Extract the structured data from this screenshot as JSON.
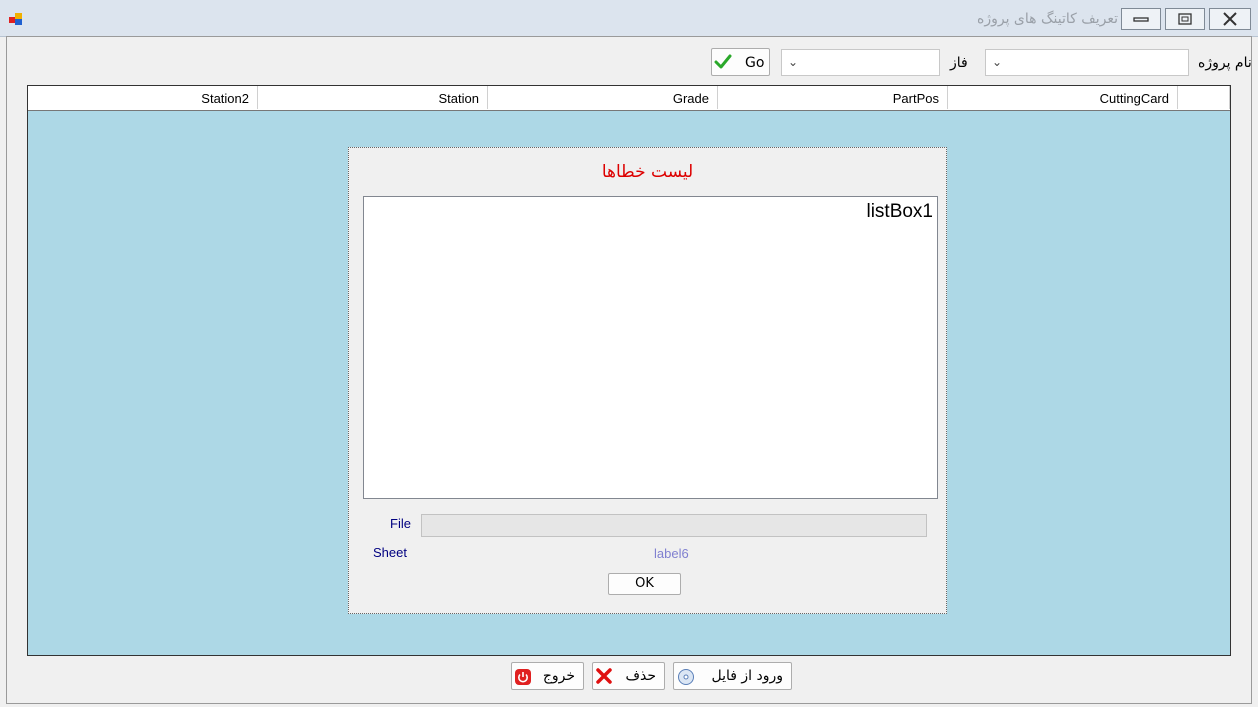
{
  "window": {
    "title": "تعریف کاتینگ های پروژه",
    "app_icon": "app-icon",
    "buttons": {
      "minimize": "minimize-icon",
      "maximize": "maximize-icon",
      "close": "close-icon"
    }
  },
  "filters": {
    "project_label": "نام پروژه",
    "project_value": "",
    "phase_label": "فاز",
    "phase_value": "",
    "go_label": "Go"
  },
  "grid": {
    "columns": [
      "CuttingCard",
      "PartPos",
      "Grade",
      "Station",
      "Station2"
    ],
    "rows": []
  },
  "dialog": {
    "title": "لیست خطاها",
    "list_items": [
      "listBox1"
    ],
    "file_label": "File",
    "file_value": "",
    "sheet_label": "Sheet",
    "sheet_value": "label6",
    "ok_label": "OK"
  },
  "footer": {
    "import_label": "ورود از فایل",
    "delete_label": "حذف",
    "exit_label": "خروج"
  },
  "colors": {
    "grid_background": "#add8e6",
    "dialog_title": "#dd0000",
    "dialog_labels": "#000080"
  }
}
